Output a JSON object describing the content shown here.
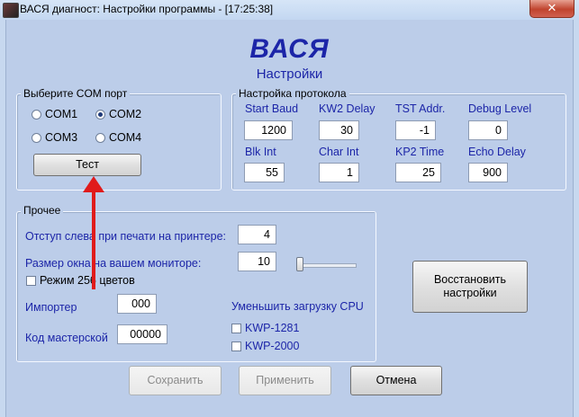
{
  "window": {
    "title": "ВАСЯ диагност: Настройки программы - [17:25:38]",
    "close_glyph": "✕"
  },
  "header": {
    "logo": "ВАСЯ",
    "subtitle": "Настройки"
  },
  "com_group": {
    "legend": "Выберите COM порт",
    "ports": [
      {
        "label": "COM1",
        "selected": false
      },
      {
        "label": "COM2",
        "selected": true
      },
      {
        "label": "COM3",
        "selected": false
      },
      {
        "label": "COM4",
        "selected": false
      }
    ],
    "test_button": "Тест"
  },
  "protocol_group": {
    "legend": "Настройка протокола",
    "fields": [
      {
        "label": "Start Baud",
        "value": "1200"
      },
      {
        "label": "KW2 Delay",
        "value": "30"
      },
      {
        "label": "TST Addr.",
        "value": "-1"
      },
      {
        "label": "Debug Level",
        "value": "0"
      },
      {
        "label": "Blk Int",
        "value": "55"
      },
      {
        "label": "Char Int",
        "value": "1"
      },
      {
        "label": "KP2 Time",
        "value": "25"
      },
      {
        "label": "Echo Delay",
        "value": "900"
      }
    ]
  },
  "other_group": {
    "legend": "Прочее",
    "print_offset_label": "Отступ слева при печати на принтере:",
    "print_offset_value": "4",
    "window_size_label": "Размер окна на вашем мониторе:",
    "window_size_value": "10",
    "mode256_label": "Режим 256 цветов",
    "importer_label": "Импортер",
    "importer_value": "000",
    "workshop_label": "Код мастерской",
    "workshop_value": "00000",
    "cpu_label": "Уменьшить загрузку CPU",
    "cpu_options": [
      {
        "label": "KWP-1281",
        "checked": false
      },
      {
        "label": "KWP-2000",
        "checked": false
      }
    ]
  },
  "buttons": {
    "restore": "Восстановить настройки",
    "save": "Сохранить",
    "apply": "Применить",
    "cancel": "Отмена"
  },
  "colors": {
    "accent": "#1c25a8",
    "annotation_arrow": "#e01b1b"
  }
}
